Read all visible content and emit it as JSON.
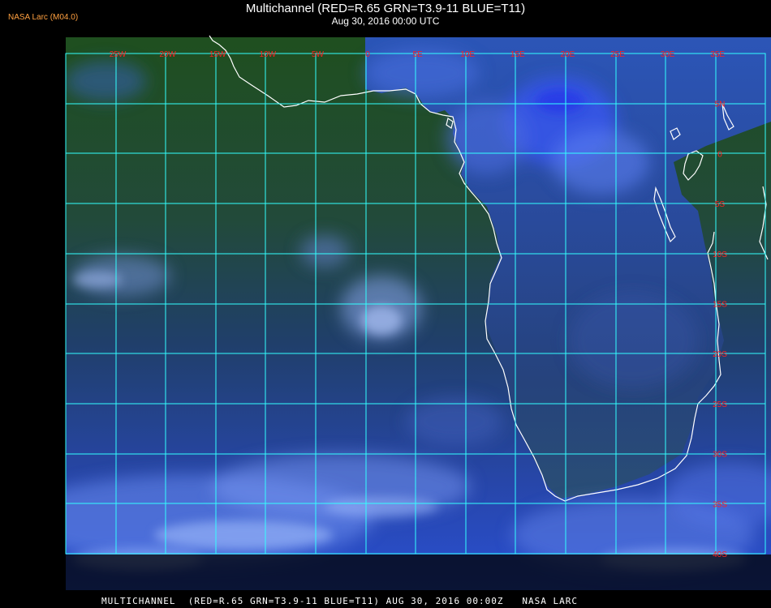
{
  "header": {
    "title": "Multichannel (RED=R.65 GRN=T3.9-11 BLUE=T11)",
    "subtitle": "Aug 30, 2016 00:00 UTC",
    "credit": "NASA Larc (M04.0)"
  },
  "footer": {
    "caption": "MULTICHANNEL  (RED=R.65 GRN=T3.9-11 BLUE=T11) AUG 30, 2016 00:00Z   NASA LARC"
  },
  "map": {
    "longitude_labels": [
      "25W",
      "20W",
      "15W",
      "10W",
      "5W",
      "0",
      "5E",
      "10E",
      "15E",
      "20E",
      "25E",
      "30E",
      "35E"
    ],
    "latitude_labels": [
      "5N",
      "0",
      "5S",
      "10S",
      "15S",
      "20S",
      "25S",
      "30S",
      "35S",
      "40S"
    ],
    "colors": {
      "grid": "#33ffff",
      "coast": "#ffffff",
      "labels": "#ff2020",
      "background": "#000000",
      "imagery_green": "#1f5a1c",
      "imagery_blue": "#2f52d6",
      "cloud_light": "#a6c6ff"
    }
  }
}
